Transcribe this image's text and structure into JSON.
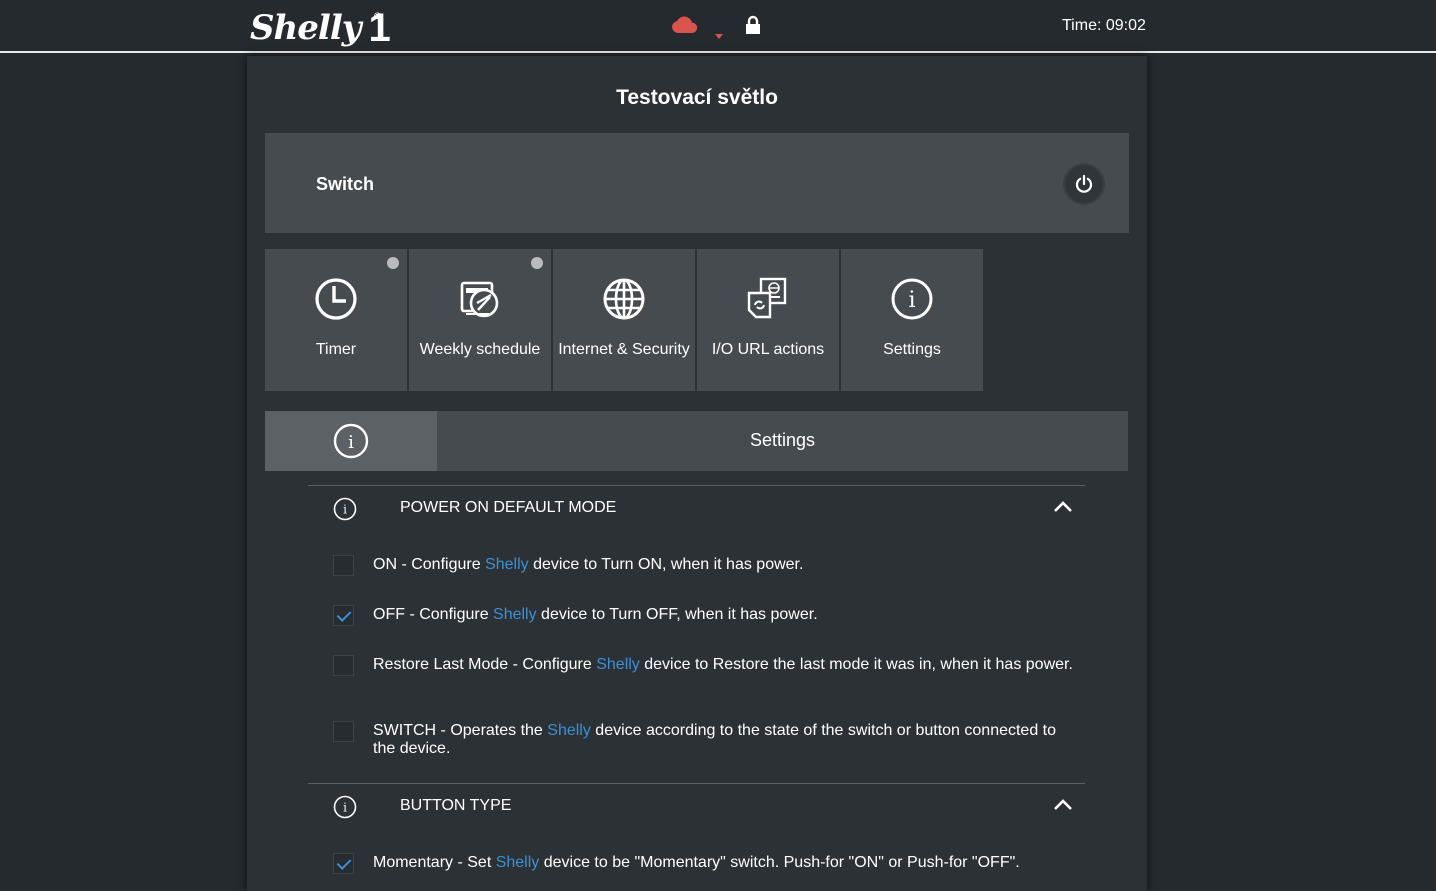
{
  "header": {
    "logo_text": "Shelly",
    "logo_number": "1",
    "logo_reg": "®",
    "time_text": "Time: 09:02",
    "icons": [
      "cloud-icon",
      "caret-down-icon",
      "lock-icon"
    ],
    "cloud_color": "#d9534f"
  },
  "device": {
    "title": "Testovací světlo",
    "switch_label": "Switch"
  },
  "tiles": [
    {
      "label": "Timer",
      "icon": "clock-icon",
      "dot": true
    },
    {
      "label": "Weekly schedule",
      "icon": "schedule-icon",
      "dot": true
    },
    {
      "label": "Internet & Security",
      "icon": "globe-icon",
      "dot": false
    },
    {
      "label": "I/O URL actions",
      "icon": "url-actions-icon",
      "dot": false
    },
    {
      "label": "Settings",
      "icon": "info-icon",
      "dot": false
    }
  ],
  "tabbar": {
    "title": "Settings"
  },
  "sections": [
    {
      "title": "POWER ON DEFAULT MODE",
      "options": [
        {
          "prefix": "ON - Configure ",
          "brand": "Shelly",
          "suffix": " device to Turn ON, when it has power.",
          "checked": false
        },
        {
          "prefix": "OFF - Configure ",
          "brand": "Shelly",
          "suffix": " device to Turn OFF, when it has power.",
          "checked": true
        },
        {
          "prefix": "Restore Last Mode - Configure ",
          "brand": "Shelly",
          "suffix": " device to Restore the last mode it was in, when it has power.",
          "checked": false
        },
        {
          "prefix": "SWITCH - Operates the ",
          "brand": "Shelly",
          "suffix": " device according to the state of the switch or button connected to the device.",
          "checked": false
        }
      ]
    },
    {
      "title": "BUTTON TYPE",
      "options": [
        {
          "prefix": "Momentary - Set ",
          "brand": "Shelly",
          "suffix": " device to be \"Momentary\" switch. Push-for \"ON\" or Push-for \"OFF\".",
          "checked": true
        }
      ]
    }
  ],
  "colors": {
    "accent": "#3d8fd6",
    "background": "#242a2d",
    "panel": "#454b4e"
  }
}
